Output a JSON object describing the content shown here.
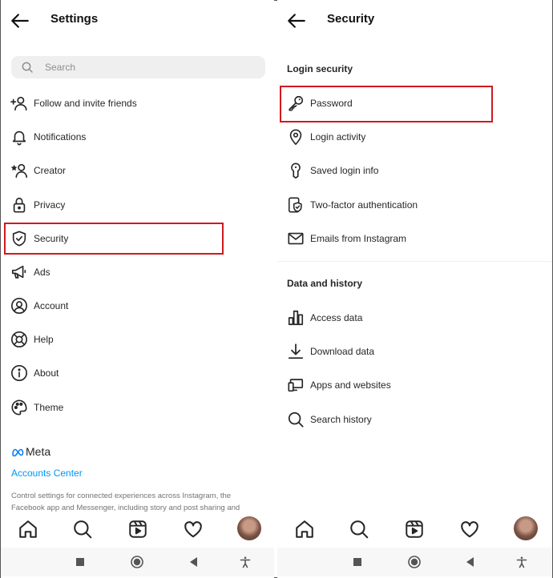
{
  "left_panel": {
    "title": "Settings",
    "search_placeholder": "Search",
    "items": [
      {
        "label": "Follow and invite friends",
        "icon": "add-person-icon"
      },
      {
        "label": "Notifications",
        "icon": "bell-icon"
      },
      {
        "label": "Creator",
        "icon": "creator-icon"
      },
      {
        "label": "Privacy",
        "icon": "lock-icon"
      },
      {
        "label": "Security",
        "icon": "shield-check-icon"
      },
      {
        "label": "Ads",
        "icon": "megaphone-icon"
      },
      {
        "label": "Account",
        "icon": "account-circle-icon"
      },
      {
        "label": "Help",
        "icon": "lifebuoy-icon"
      },
      {
        "label": "About",
        "icon": "info-icon"
      },
      {
        "label": "Theme",
        "icon": "palette-icon"
      }
    ],
    "meta": {
      "brand": "Meta",
      "accounts_center": "Accounts Center",
      "description": "Control settings for connected experiences across Instagram, the Facebook app and Messenger, including story and post sharing and"
    }
  },
  "right_panel": {
    "title": "Security",
    "section_login": "Login security",
    "login_items": [
      {
        "label": "Password",
        "icon": "key-icon"
      },
      {
        "label": "Login activity",
        "icon": "location-pin-icon"
      },
      {
        "label": "Saved login info",
        "icon": "keyhole-icon"
      },
      {
        "label": "Two-factor authentication",
        "icon": "shield-device-icon"
      },
      {
        "label": "Emails from Instagram",
        "icon": "envelope-icon"
      }
    ],
    "section_data": "Data and history",
    "data_items": [
      {
        "label": "Access data",
        "icon": "bar-chart-icon"
      },
      {
        "label": "Download data",
        "icon": "download-icon"
      },
      {
        "label": "Apps and websites",
        "icon": "laptop-icon"
      },
      {
        "label": "Search history",
        "icon": "search-icon"
      }
    ]
  },
  "highlights": {
    "left_selected": "Security",
    "right_selected": "Password",
    "color": "#d0191f"
  },
  "tab_bar": [
    "home-icon",
    "search-icon",
    "reels-icon",
    "heart-icon",
    "profile-avatar"
  ],
  "system_nav": [
    "recents-square-icon",
    "home-circle-icon",
    "back-triangle-icon",
    "accessibility-icon"
  ],
  "colors": {
    "link": "#0095f6",
    "text": "#262626",
    "muted": "#737373",
    "search_bg": "#efefef"
  }
}
